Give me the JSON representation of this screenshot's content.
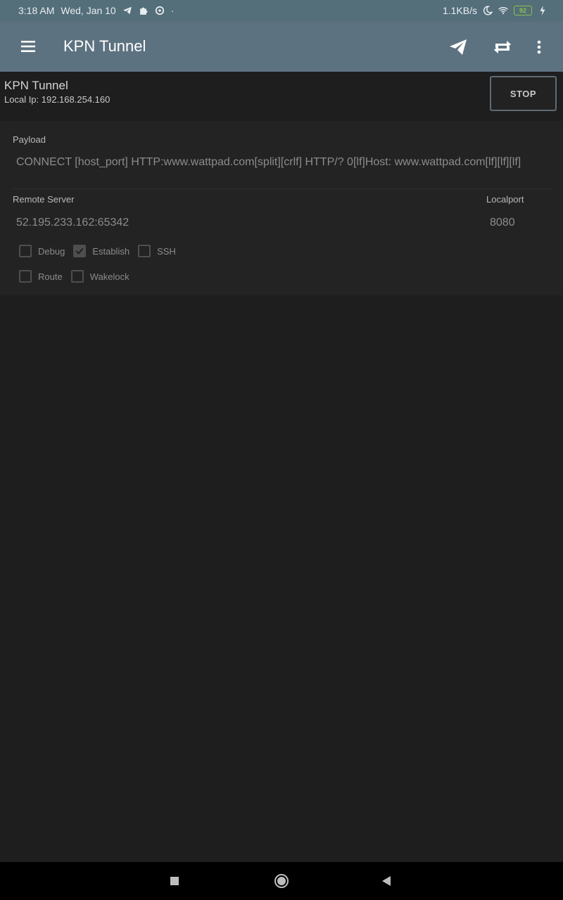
{
  "status_bar": {
    "time": "3:18 AM",
    "date": "Wed, Jan 10",
    "dot": "·",
    "net_speed": "1.1KB/s",
    "battery": "92",
    "icons": [
      "telegram-icon",
      "puzzle-icon",
      "sync-circle-icon",
      "moon-icon",
      "wifi-icon",
      "battery-icon",
      "charging-bolt-icon"
    ]
  },
  "toolbar": {
    "title": "KPN Tunnel",
    "actions": [
      "menu-icon",
      "send-icon",
      "repeat-icon",
      "more-vert-icon"
    ]
  },
  "status_panel": {
    "title": "KPN Tunnel",
    "local_ip": "Local Ip: 192.168.254.160",
    "stop_label": "STOP"
  },
  "config": {
    "payload_label": "Payload",
    "payload_value": "CONNECT [host_port] HTTP:www.wattpad.com[split][crlf] HTTP/? 0[lf]Host: www.wattpad.com[lf][lf][lf]",
    "remote_label": "Remote Server",
    "remote_value": "52.195.233.162:65342",
    "localport_label": "Localport",
    "localport_value": "8080",
    "options": [
      {
        "label": "Debug",
        "checked": false
      },
      {
        "label": "Establish",
        "checked": true
      },
      {
        "label": "SSH",
        "checked": false
      },
      {
        "label": "Route",
        "checked": false
      },
      {
        "label": "Wakelock",
        "checked": false
      }
    ]
  },
  "colors": {
    "toolbar": "#5d7280",
    "statusbar": "#546e7a",
    "background": "#1e1e1e",
    "battery": "#8bc34a"
  }
}
